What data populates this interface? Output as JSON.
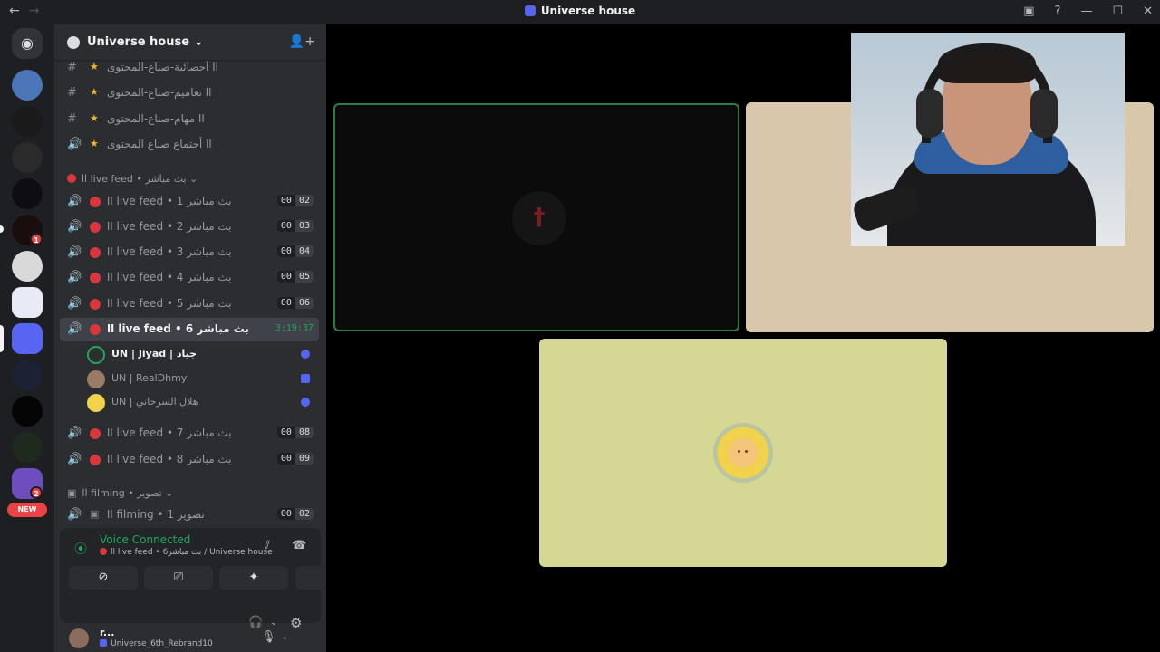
{
  "titlebar": {
    "title": "Universe house",
    "nav_back": "←",
    "nav_forward": "→",
    "inbox_icon": "inbox-icon",
    "help": "?",
    "minimize": "—",
    "maximize": "☐",
    "close": "✕"
  },
  "servers": {
    "badges": [
      "1",
      "2"
    ],
    "new_label": "NEW"
  },
  "guild": {
    "name": "Universe house",
    "chevron": "⌄"
  },
  "channels": {
    "text_items": [
      {
        "icon": "#",
        "label": "اا أحصائية-صناع-المحتوى"
      },
      {
        "icon": "#",
        "label": "اا تعاميم-صناع-المحتوى"
      },
      {
        "icon": "#",
        "label": "اا مهام-صناع-المحتوى"
      },
      {
        "icon": "🔊",
        "label": "اا أجتماع صناع المحتوى"
      }
    ],
    "category_live": "اا live feed • بث مباشر ⌄",
    "voice_items": [
      {
        "label": "اا live feed • بث مباشر 1",
        "a": "00",
        "b": "02"
      },
      {
        "label": "اا live feed • بث مباشر 2",
        "a": "00",
        "b": "03"
      },
      {
        "label": "اا live feed • بث مباشر 3",
        "a": "00",
        "b": "04"
      },
      {
        "label": "اا live feed • بث مباشر 4",
        "a": "00",
        "b": "05"
      },
      {
        "label": "اا live feed • بث مباشر 5",
        "a": "00",
        "b": "06"
      }
    ],
    "active_item": {
      "label": "اا live feed • بث مباشر 6",
      "timer": "3:19:37"
    },
    "users": [
      {
        "name": "UN | Jiyad | جياد"
      },
      {
        "name": "UN | RealDhmy"
      },
      {
        "name": "UN | هلال السرحاني"
      }
    ],
    "voice_items_after": [
      {
        "label": "اا live feed • بث مباشر 7",
        "a": "00",
        "b": "08"
      },
      {
        "label": "اا live feed • بث مباشر 8",
        "a": "00",
        "b": "09"
      }
    ],
    "category_filming": "اا filming • تصوير ⌄",
    "filming_item": {
      "label": "اا filming • تصوير 1",
      "a": "00",
      "b": "02"
    }
  },
  "voice_panel": {
    "title": "Voice Connected",
    "subtitle": "اا live feed • بث مباشر6 / Universe house"
  },
  "me": {
    "name": "r...",
    "status": "Universe_6th_Rebrand10"
  }
}
